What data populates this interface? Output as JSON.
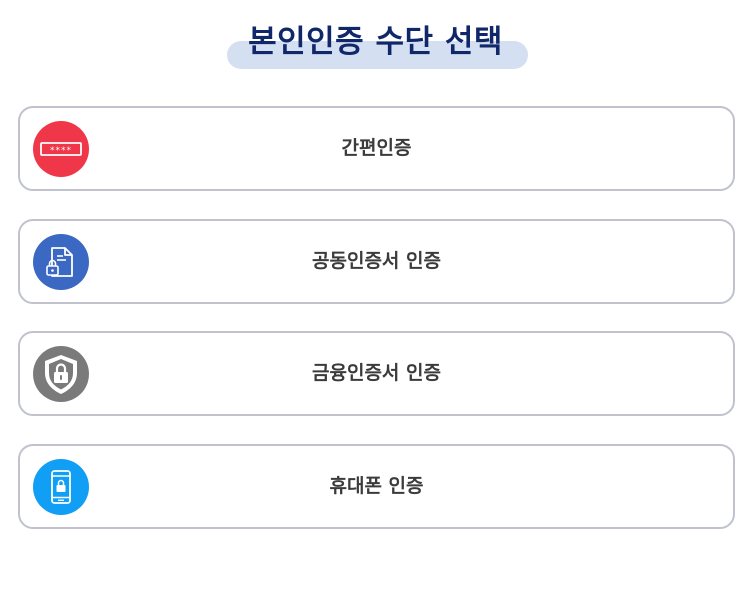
{
  "page": {
    "title": "본인인증 수단 선택"
  },
  "options": [
    {
      "label": "간편인증",
      "icon": "password-icon",
      "color": "#f0374a"
    },
    {
      "label": "공동인증서 인증",
      "icon": "certificate-document-icon",
      "color": "#3a68c2"
    },
    {
      "label": "금융인증서 인증",
      "icon": "shield-lock-icon",
      "color": "#7a7a7a"
    },
    {
      "label": "휴대폰 인증",
      "icon": "mobile-lock-icon",
      "color": "#109ff5"
    }
  ],
  "colors": {
    "title": "#10286a",
    "title_highlight": "#d4dff1",
    "card_border": "#c0c3cd",
    "label": "#3b3b3b"
  }
}
